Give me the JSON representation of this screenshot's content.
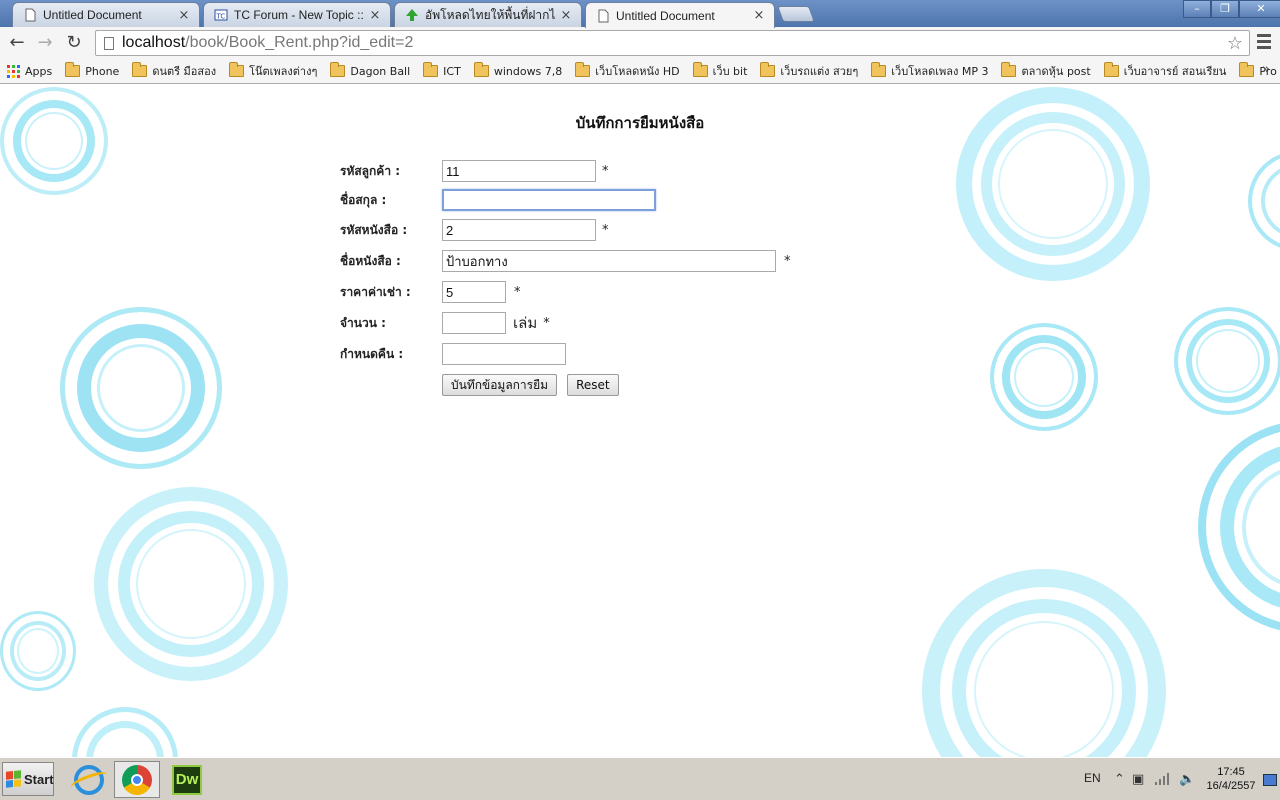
{
  "browser": {
    "tabs": [
      {
        "title": "Untitled Document",
        "icon": "page-icon",
        "active": false
      },
      {
        "title": "TC Forum - New Topic :: เริ่ม",
        "icon": "forum-icon",
        "active": false
      },
      {
        "title": "อัพโหลดไทยให้พื้นที่ฝากไฟล์",
        "icon": "upload-arrow-icon",
        "active": false
      },
      {
        "title": "Untitled Document",
        "icon": "page-icon",
        "active": true
      }
    ],
    "close_glyph": "×",
    "nav": {
      "back": "←",
      "forward": "→",
      "reload": "↻"
    },
    "url_host": "localhost",
    "url_path": "/book/Book_Rent.php?id_edit=2",
    "star": "☆",
    "bookmarks": [
      {
        "label": "Apps",
        "icon": "apps-grid-icon"
      },
      {
        "label": "Phone",
        "icon": "folder-icon"
      },
      {
        "label": "ดนตรี มือสอง",
        "icon": "folder-icon"
      },
      {
        "label": "โน๊ตเพลงต่างๆ",
        "icon": "folder-icon"
      },
      {
        "label": "Dagon Ball",
        "icon": "folder-icon"
      },
      {
        "label": "ICT",
        "icon": "folder-icon"
      },
      {
        "label": "windows 7,8",
        "icon": "folder-icon"
      },
      {
        "label": "เว็บโหลดหนัง HD",
        "icon": "folder-icon"
      },
      {
        "label": "เว็บ bit",
        "icon": "folder-icon"
      },
      {
        "label": "เว็บรถแต่ง สวยๆ",
        "icon": "folder-icon"
      },
      {
        "label": "เว็บโหลดเพลง MP 3",
        "icon": "folder-icon"
      },
      {
        "label": "ตลาดหุ้น post",
        "icon": "folder-icon"
      },
      {
        "label": "เว็บอาจารย์ สอนเรียน",
        "icon": "folder-icon"
      },
      {
        "label": "Pro PB",
        "icon": "folder-icon"
      }
    ],
    "more": "»"
  },
  "form": {
    "title": "บันทึกการยืมหนังสือ",
    "fields": {
      "customer_id": {
        "label": "รหัสลูกค้า :",
        "value": "11",
        "required": "*"
      },
      "full_name": {
        "label": "ชื่อสกุล :",
        "value": ""
      },
      "book_id": {
        "label": "รหัสหนังสือ :",
        "value": "2",
        "required": "*"
      },
      "book_name": {
        "label": "ชื่อหนังสือ :",
        "value": "ป้าบอกทาง",
        "required": "*"
      },
      "rent_price": {
        "label": "ราคาค่าเช่า :",
        "value": "5",
        "required": "*"
      },
      "quantity": {
        "label": "จำนวน :",
        "value": "",
        "unit": "เล่ม",
        "required": "*"
      },
      "return_date": {
        "label": "กำหนดคืน :",
        "value": ""
      }
    },
    "submit_label": "บันทึกข้อมูลการยืม",
    "reset_label": "Reset"
  },
  "taskbar": {
    "start_label": "Start",
    "apps": [
      {
        "name": "internet-explorer",
        "icon": "ie-icon"
      },
      {
        "name": "google-chrome",
        "icon": "chrome-icon",
        "active": true
      },
      {
        "name": "dreamweaver",
        "icon": "dw-icon",
        "label": "Dw"
      }
    ],
    "language": "EN",
    "time": "17:45",
    "date": "16/4/2557"
  },
  "colors": {
    "ring": "#9fe6f5",
    "ring_light": "#cdf3fb",
    "tabstrip": "#5a7fb8"
  }
}
